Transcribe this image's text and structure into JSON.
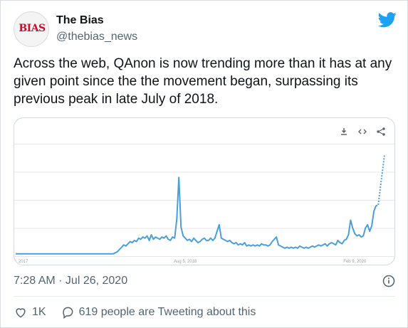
{
  "tweet": {
    "display_name": "The Bias",
    "handle": "@thebias_news",
    "avatar_logo_text": "BIAS",
    "text": "Across the web, QAnon is now trending more than it has at any given point since the the movement began, surpassing its previous peak in late July of 2018.",
    "timestamp": "7:28 AM · Jul 26, 2020",
    "likes": "1K",
    "replies_text": "619 people are Tweeting about this"
  },
  "icons": {
    "brand": "twitter-bird-icon",
    "download": "download-icon",
    "embed": "embed-icon",
    "share": "share-icon",
    "info": "info-icon",
    "like": "heart-icon",
    "reply": "speech-bubble-icon"
  },
  "colors": {
    "twitter_blue": "#1da1f2",
    "line_blue": "#4a9fdb",
    "text_secondary": "#536471",
    "brand_red": "#c8102e"
  },
  "chart_data": {
    "type": "line",
    "title": "",
    "xlabel": "",
    "ylabel": "",
    "x_tick_labels": [
      "Jan 29, 2017",
      "Aug 5, 2018",
      "Feb 9, 2020"
    ],
    "x_tick_index": [
      0,
      80,
      160
    ],
    "ylim": [
      0,
      100
    ],
    "grid": true,
    "series": [
      {
        "values": [
          2,
          2,
          2,
          2,
          2,
          2,
          2,
          2,
          2,
          2,
          2,
          2,
          2,
          2,
          2,
          2,
          2,
          2,
          2,
          2,
          2,
          2,
          2,
          2,
          2,
          2,
          2,
          2,
          2,
          2,
          2,
          2,
          2,
          2,
          2,
          2,
          2,
          2,
          2,
          2,
          2,
          2,
          2,
          2,
          2,
          2,
          2,
          3,
          4,
          6,
          8,
          10,
          9,
          11,
          13,
          12,
          14,
          13,
          16,
          15,
          17,
          16,
          18,
          14,
          19,
          15,
          17,
          16,
          15,
          17,
          16,
          18,
          15,
          14,
          17,
          16,
          33,
          70,
          26,
          18,
          16,
          14,
          15,
          13,
          16,
          14,
          12,
          13,
          15,
          16,
          14,
          14,
          16,
          14,
          16,
          22,
          28,
          16,
          15,
          14,
          13,
          14,
          12,
          11,
          12,
          10,
          11,
          10,
          12,
          9,
          10,
          9,
          10,
          9,
          10,
          9,
          11,
          10,
          10,
          9,
          10,
          13,
          15,
          17,
          10,
          9,
          8,
          7,
          8,
          7,
          8,
          7,
          8,
          7,
          9,
          8,
          7,
          8,
          7,
          8,
          9,
          8,
          9,
          10,
          9,
          10,
          11,
          9,
          11,
          12,
          11,
          10,
          14,
          12,
          11,
          14,
          15,
          19,
          32,
          25,
          20,
          18,
          19,
          17,
          18,
          25,
          28,
          22,
          27,
          40,
          45
        ]
      },
      {
        "style": "dotted",
        "values_from_index": 171,
        "values": [
          45,
          60,
          75,
          90
        ]
      }
    ]
  }
}
